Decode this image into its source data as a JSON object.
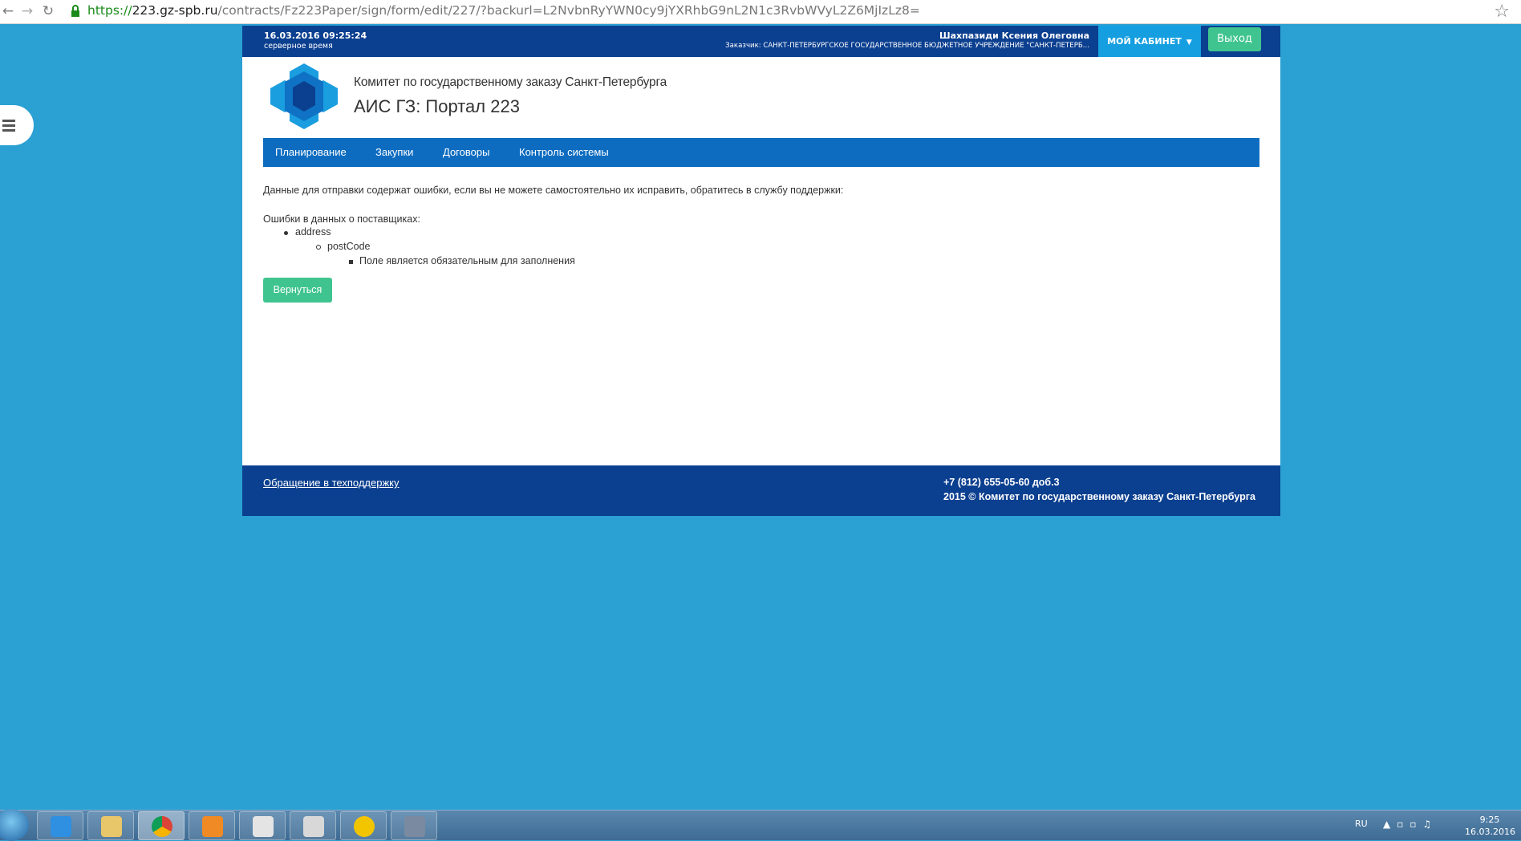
{
  "browser": {
    "url_scheme": "https://",
    "url_host": "223.gz-spb.ru",
    "url_path": "/contracts/Fz223Paper/sign/form/edit/227/?backurl=L2NvbnRyYWN0cy9jYXRhbG9nL2N1c3RvbWVyL2Z6MjIzLz8="
  },
  "header": {
    "datetime": "16.03.2016 09:25:24",
    "server_time_label": "серверное время",
    "user_name": "Шахпазиди Ксения Олеговна",
    "customer": "Заказчик: САНКТ-ПЕТЕРБУРГСКОЕ ГОСУДАРСТВЕННОЕ БЮДЖЕТНОЕ УЧРЕЖДЕНИЕ \"САНКТ-ПЕТЕРБ...",
    "cabinet_label": "МОЙ КАБИНЕТ",
    "logout_label": "Выход"
  },
  "brand": {
    "org_name": "Комитет по государственному заказу Санкт-Петербурга",
    "portal_name": "АИС ГЗ: Портал 223"
  },
  "nav": {
    "items": [
      {
        "label": "Планирование"
      },
      {
        "label": "Закупки"
      },
      {
        "label": "Договоры"
      },
      {
        "label": "Контроль системы"
      }
    ]
  },
  "content": {
    "message": "Данные для отправки содержат ошибки, если вы не можете самостоятельно их исправить, обратитесь в службу поддержки:",
    "errors_title": "Ошибки в данных о поставщиках:",
    "level1": "address",
    "level2": "postCode",
    "level3": "Поле является обязательным для заполнения",
    "back_button": "Вернуться"
  },
  "footer": {
    "support_link": "Обращение в техподдержку",
    "phone": "+7 (812) 655-05-60 доб.3",
    "copyright": "2015 © Комитет по государственному заказу Санкт-Петербурга"
  },
  "taskbar": {
    "lang": "RU",
    "time": "9:25",
    "date": "16.03.2016"
  },
  "colors": {
    "page_bg": "#2aa0d3",
    "header_blue": "#0b3f8f",
    "nav_blue": "#0d6cc0",
    "cabinet_blue": "#169fe0",
    "green_button": "#40c48f"
  }
}
